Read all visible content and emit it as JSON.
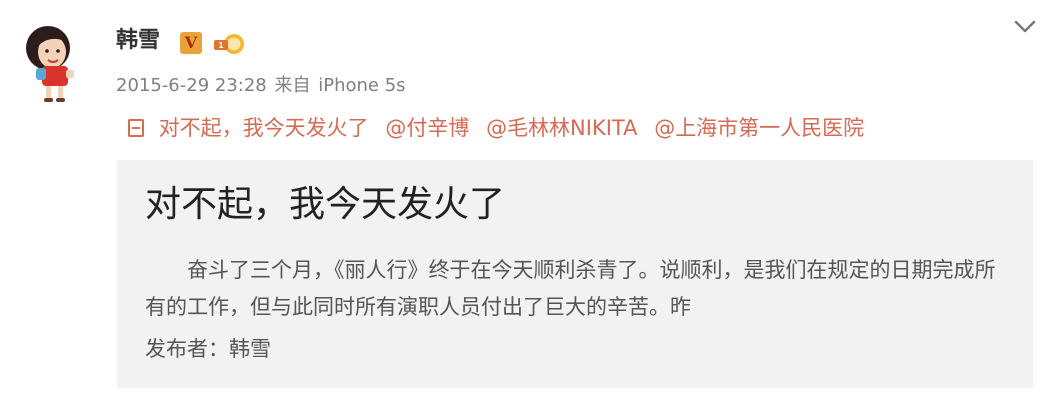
{
  "post": {
    "user_name": "韩雪",
    "verified_badge": "V",
    "level_badge_icon": "level-badge-icon",
    "timestamp": "2015-6-29 23:28",
    "source_prefix": "来自",
    "source_device": "iPhone 5s",
    "headline_title": "对不起，我今天发火了",
    "mentions": [
      "@付辛博",
      "@毛林林NIKITA",
      "@上海市第一人民医院"
    ]
  },
  "article_card": {
    "title": "对不起，我今天发火了",
    "body": "奋斗了三个月，《丽人行》终于在今天顺利杀青了。说顺利，是我们在规定的日期完成所有的工作，但与此同时所有演职人员付出了巨大的辛苦。昨",
    "author": "发布者：韩雪"
  },
  "colors": {
    "link": "#d66a52",
    "meta": "#808080",
    "card_background": "#f2f2f2",
    "verified": "#e8a33a"
  }
}
